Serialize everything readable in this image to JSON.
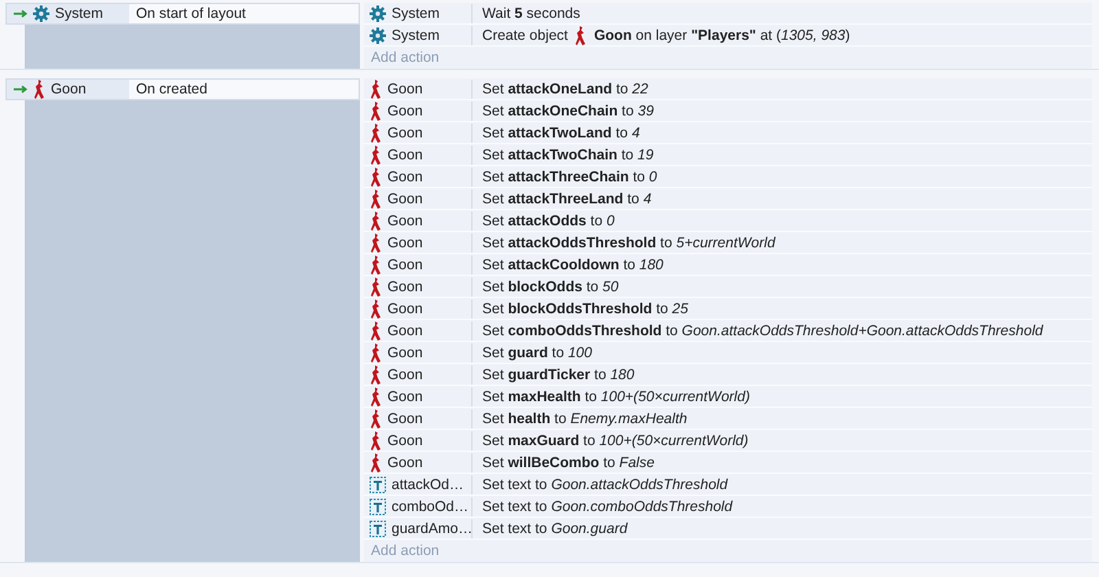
{
  "events": [
    {
      "conditions": [
        {
          "object": "System",
          "kind": "system",
          "text": "On start of layout"
        }
      ],
      "actions": [
        {
          "object": "System",
          "kind": "system",
          "segments": [
            {
              "kind": "text",
              "text": "Wait **5** seconds"
            }
          ]
        },
        {
          "object": "System",
          "kind": "system",
          "segments": [
            {
              "kind": "text",
              "text": "Create object"
            },
            {
              "kind": "figure"
            },
            {
              "kind": "text",
              "text": "**Goon** on layer **\"Players\"** at (*1305, 983*)"
            }
          ]
        }
      ],
      "add_action": "Add action"
    },
    {
      "conditions": [
        {
          "object": "Goon",
          "kind": "figure",
          "text": "On created"
        }
      ],
      "actions": [
        {
          "object": "Goon",
          "kind": "figure",
          "segments": [
            {
              "kind": "text",
              "text": "Set **attackOneLand** to *22*"
            }
          ]
        },
        {
          "object": "Goon",
          "kind": "figure",
          "segments": [
            {
              "kind": "text",
              "text": "Set **attackOneChain** to *39*"
            }
          ]
        },
        {
          "object": "Goon",
          "kind": "figure",
          "segments": [
            {
              "kind": "text",
              "text": "Set **attackTwoLand** to *4*"
            }
          ]
        },
        {
          "object": "Goon",
          "kind": "figure",
          "segments": [
            {
              "kind": "text",
              "text": "Set **attackTwoChain** to *19*"
            }
          ]
        },
        {
          "object": "Goon",
          "kind": "figure",
          "segments": [
            {
              "kind": "text",
              "text": "Set **attackThreeChain** to *0*"
            }
          ]
        },
        {
          "object": "Goon",
          "kind": "figure",
          "segments": [
            {
              "kind": "text",
              "text": "Set **attackThreeLand** to *4*"
            }
          ]
        },
        {
          "object": "Goon",
          "kind": "figure",
          "segments": [
            {
              "kind": "text",
              "text": "Set **attackOdds** to *0*"
            }
          ]
        },
        {
          "object": "Goon",
          "kind": "figure",
          "segments": [
            {
              "kind": "text",
              "text": "Set **attackOddsThreshold** to *5+currentWorld*"
            }
          ]
        },
        {
          "object": "Goon",
          "kind": "figure",
          "segments": [
            {
              "kind": "text",
              "text": "Set **attackCooldown** to *180*"
            }
          ]
        },
        {
          "object": "Goon",
          "kind": "figure",
          "segments": [
            {
              "kind": "text",
              "text": "Set **blockOdds** to *50*"
            }
          ]
        },
        {
          "object": "Goon",
          "kind": "figure",
          "segments": [
            {
              "kind": "text",
              "text": "Set **blockOddsThreshold** to *25*"
            }
          ]
        },
        {
          "object": "Goon",
          "kind": "figure",
          "segments": [
            {
              "kind": "text",
              "text": "Set **comboOddsThreshold** to *Goon.attackOddsThreshold+Goon.attackOddsThreshold*"
            }
          ]
        },
        {
          "object": "Goon",
          "kind": "figure",
          "segments": [
            {
              "kind": "text",
              "text": "Set **guard** to *100*"
            }
          ]
        },
        {
          "object": "Goon",
          "kind": "figure",
          "segments": [
            {
              "kind": "text",
              "text": "Set **guardTicker** to *180*"
            }
          ]
        },
        {
          "object": "Goon",
          "kind": "figure",
          "segments": [
            {
              "kind": "text",
              "text": "Set **maxHealth** to *100+(50×currentWorld)*"
            }
          ]
        },
        {
          "object": "Goon",
          "kind": "figure",
          "segments": [
            {
              "kind": "text",
              "text": "Set **health** to *Enemy.maxHealth*"
            }
          ]
        },
        {
          "object": "Goon",
          "kind": "figure",
          "segments": [
            {
              "kind": "text",
              "text": "Set **maxGuard** to *100+(50×currentWorld)*"
            }
          ]
        },
        {
          "object": "Goon",
          "kind": "figure",
          "segments": [
            {
              "kind": "text",
              "text": "Set **willBeCombo** to *False*"
            }
          ]
        },
        {
          "object": "attackOd…",
          "kind": "textobject",
          "segments": [
            {
              "kind": "text",
              "text": "Set text to *Goon.attackOddsThreshold*"
            }
          ]
        },
        {
          "object": "comboOd…",
          "kind": "textobject",
          "segments": [
            {
              "kind": "text",
              "text": "Set text to *Goon.comboOddsThreshold*"
            }
          ]
        },
        {
          "object": "guardAmo…",
          "kind": "textobject",
          "segments": [
            {
              "kind": "text",
              "text": "Set text to *Goon.guard*"
            }
          ]
        }
      ],
      "add_action": "Add action"
    }
  ]
}
